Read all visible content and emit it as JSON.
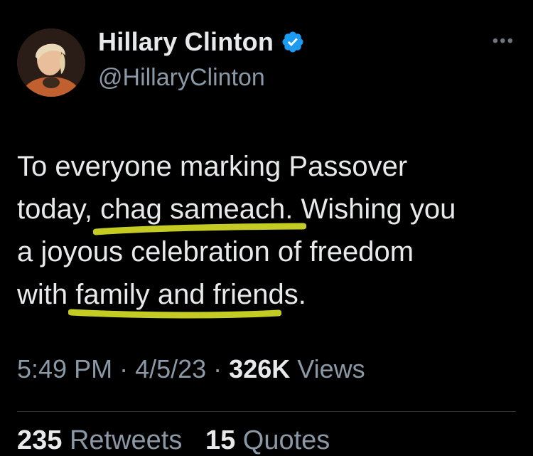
{
  "author": {
    "display_name": "Hillary Clinton",
    "handle": "@HillaryClinton",
    "verified": true,
    "avatar_icon": "profile-photo-icon"
  },
  "more_icon": "more-options-icon",
  "tweet": {
    "line1": "To everyone marking Passover",
    "line2_pre": "today, ",
    "line2_highlight": "chag sameach",
    "line2_post": ". Wishing you",
    "line3": "a joyous celebration of freedom",
    "line4_pre": "with ",
    "line4_highlight": "family and friends",
    "line4_post": "."
  },
  "meta": {
    "time": "5:49 PM",
    "sep1": " · ",
    "date": "4/5/23",
    "sep2": " · ",
    "views_count": "326K",
    "views_label": " Views"
  },
  "stats": {
    "retweets_count": "235",
    "retweets_label": " Retweets",
    "quotes_count": "15",
    "quotes_label": " Quotes"
  },
  "colors": {
    "background": "#000000",
    "text": "#e7e9ea",
    "secondary": "#8b98a5",
    "verified": "#1d9bf0",
    "highlighter": "#e6f02a"
  }
}
